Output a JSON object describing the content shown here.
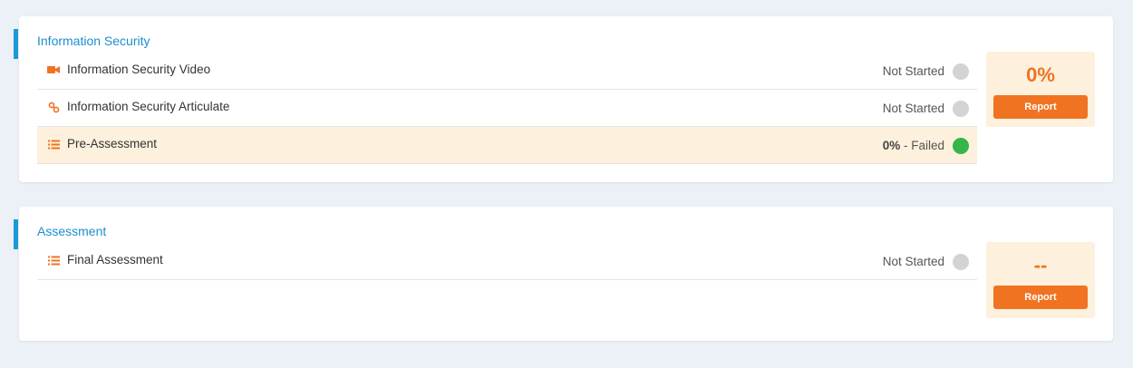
{
  "colors": {
    "accent": "#1a9ad6",
    "orange": "#f07322",
    "highlight": "#fdf0dc",
    "success": "#35b54a",
    "pending": "#d3d3d3"
  },
  "sections": [
    {
      "title": "Information Security",
      "score": "0%",
      "report_label": "Report",
      "items": [
        {
          "icon": "video-camera-icon",
          "label": "Information Security Video",
          "status": "Not Started"
        },
        {
          "icon": "link-icon",
          "label": "Information Security Articulate",
          "status": "Not Started"
        },
        {
          "icon": "list-icon",
          "label": "Pre-Assessment",
          "status_value": "0%",
          "status": " - Failed"
        }
      ]
    },
    {
      "title": "Assessment",
      "score": "--",
      "report_label": "Report",
      "items": [
        {
          "icon": "list-icon",
          "label": "Final Assessment",
          "status": "Not Started"
        }
      ]
    }
  ]
}
